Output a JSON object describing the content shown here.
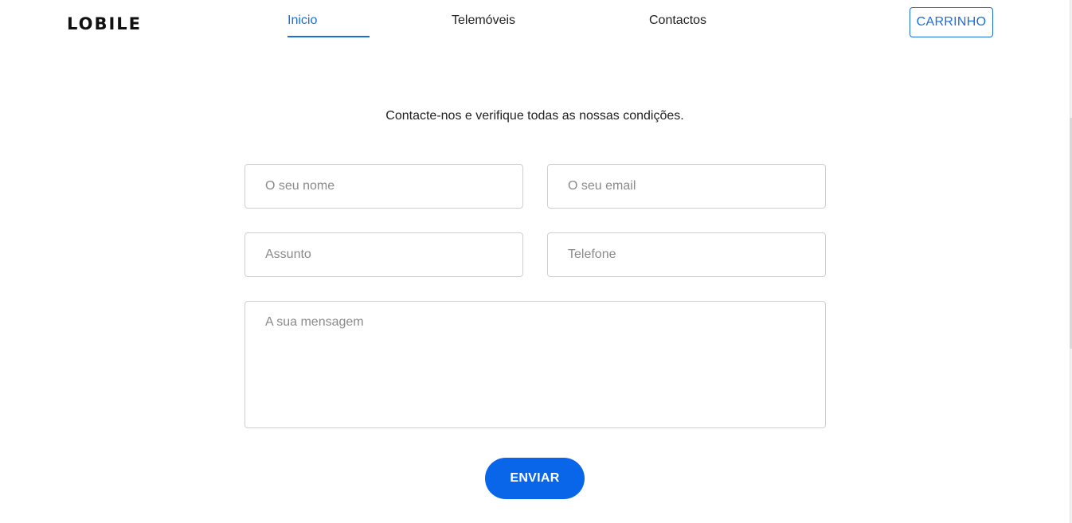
{
  "brand": {
    "logo_text": "LOBILE"
  },
  "nav": {
    "items": [
      {
        "label": "Inicio",
        "active": true
      },
      {
        "label": "Telemóveis",
        "active": false
      },
      {
        "label": "Contactos",
        "active": false
      }
    ],
    "cart_label": "CARRINHO"
  },
  "contact": {
    "intro": "Contacte-nos e verifique todas as nossas condições.",
    "fields": {
      "name_placeholder": "O seu nome",
      "email_placeholder": "O seu email",
      "subject_placeholder": "Assunto",
      "phone_placeholder": "Telefone",
      "message_placeholder": "A sua mensagem"
    },
    "submit_label": "ENVIAR"
  },
  "colors": {
    "accent": "#1a6fd8",
    "button_bg": "#0a66e8",
    "border": "#cfcfcf",
    "placeholder": "#8a8a8a"
  }
}
